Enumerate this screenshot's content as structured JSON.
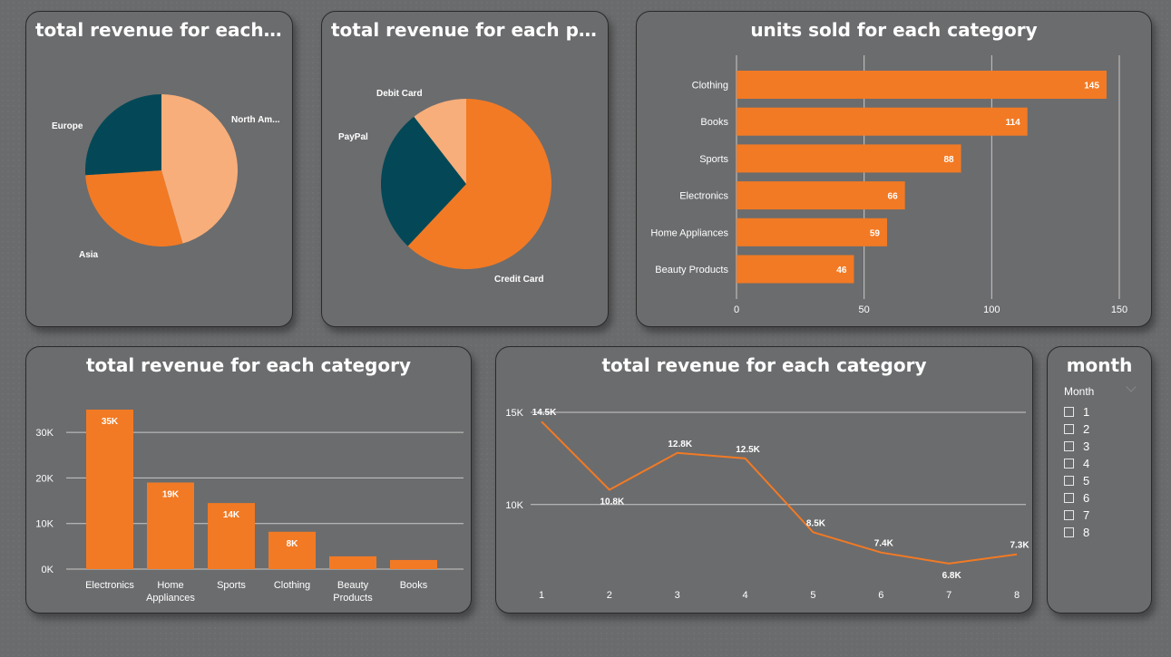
{
  "colors": {
    "orange": "#f27a24",
    "peach": "#f7ae7a",
    "teal": "#044857",
    "card": "#6b6c6e",
    "text": "#ffffff",
    "grid": "#c8c8c8"
  },
  "slicer": {
    "title": "month",
    "header": "Month",
    "items": [
      "1",
      "2",
      "3",
      "4",
      "5",
      "6",
      "7",
      "8"
    ]
  },
  "chart_data": [
    {
      "id": "region_pie",
      "type": "pie",
      "title": "total revenue for each re...",
      "slices": [
        {
          "label": "North Am...",
          "value": 45.5,
          "color": "#f7ae7a"
        },
        {
          "label": "Asia",
          "value": 28.5,
          "color": "#f27a24"
        },
        {
          "label": "Europe",
          "value": 26.0,
          "color": "#044857"
        }
      ]
    },
    {
      "id": "payment_pie",
      "type": "pie",
      "title": "total revenue for each paym...",
      "slices": [
        {
          "label": "Credit Card",
          "value": 62.0,
          "color": "#f27a24"
        },
        {
          "label": "PayPal",
          "value": 27.5,
          "color": "#044857"
        },
        {
          "label": "Debit Card",
          "value": 10.5,
          "color": "#f7ae7a"
        }
      ]
    },
    {
      "id": "units_bar",
      "type": "bar",
      "orientation": "horizontal",
      "title": "units sold for each category",
      "categories": [
        "Clothing",
        "Books",
        "Sports",
        "Electronics",
        "Home Appliances",
        "Beauty Products"
      ],
      "values": [
        145,
        114,
        88,
        66,
        59,
        46
      ],
      "data_labels": [
        "145",
        "114",
        "88",
        "66",
        "59",
        "46"
      ],
      "xlim": [
        0,
        150
      ],
      "ticks": [
        0,
        50,
        100,
        150
      ],
      "tick_labels": [
        "0",
        "50",
        "100",
        "150"
      ],
      "grid": true
    },
    {
      "id": "revenue_category_bar",
      "type": "bar",
      "orientation": "vertical",
      "title": "total revenue for each category",
      "categories": [
        "Electronics",
        "Home Appliances",
        "Sports",
        "Clothing",
        "Beauty Products",
        "Books"
      ],
      "category_lines": [
        [
          "Electronics"
        ],
        [
          "Home",
          "Appliances"
        ],
        [
          "Sports"
        ],
        [
          "Clothing"
        ],
        [
          "Beauty",
          "Products"
        ],
        [
          "Books"
        ]
      ],
      "values": [
        35000,
        19000,
        14500,
        8200,
        2800,
        2000
      ],
      "data_labels": [
        "35K",
        "19K",
        "14K",
        "8K",
        "",
        ""
      ],
      "ylim": [
        0,
        35000
      ],
      "ticks": [
        0,
        10000,
        20000,
        30000
      ],
      "tick_labels": [
        "0K",
        "10K",
        "20K",
        "30K"
      ],
      "grid": true
    },
    {
      "id": "revenue_month_line",
      "type": "line",
      "title": "total revenue for each category",
      "x": [
        1,
        2,
        3,
        4,
        5,
        6,
        7,
        8
      ],
      "x_labels": [
        "1",
        "2",
        "3",
        "4",
        "5",
        "6",
        "7",
        "8"
      ],
      "values": [
        14500,
        10800,
        12800,
        12500,
        8500,
        7400,
        6800,
        7300
      ],
      "data_labels": [
        "14.5K",
        "10.8K",
        "12.8K",
        "12.5K",
        "8.5K",
        "7.4K",
        "6.8K",
        "7.3K"
      ],
      "label_pos": [
        "above",
        "below",
        "above",
        "above",
        "above",
        "above",
        "below",
        "above"
      ],
      "ylim": [
        6500,
        15000
      ],
      "ticks": [
        10000,
        15000
      ],
      "tick_labels": [
        "10K",
        "15K"
      ],
      "grid": true
    }
  ]
}
